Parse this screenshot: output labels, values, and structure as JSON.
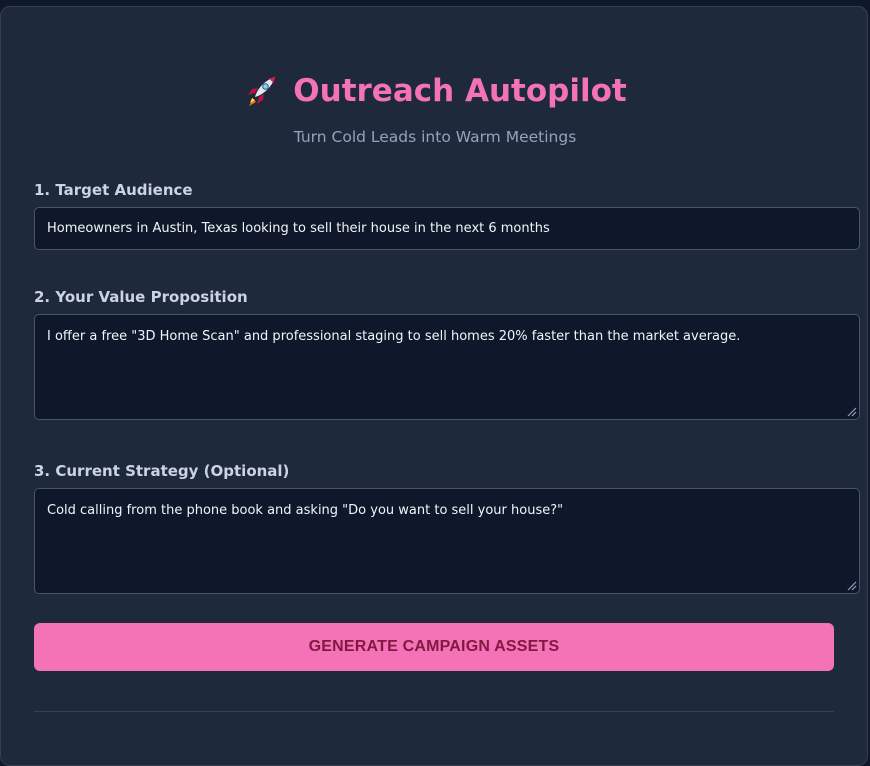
{
  "header": {
    "title": "Outreach Autopilot",
    "subtitle": "Turn Cold Leads into Warm Meetings",
    "icon": "rocket-icon"
  },
  "form": {
    "audience": {
      "label": "1. Target Audience",
      "value": "Homeowners in Austin, Texas looking to sell their house in the next 6 months"
    },
    "value_prop": {
      "label": "2. Your Value Proposition",
      "value": "I offer a free \"3D Home Scan\" and professional staging to sell homes 20% faster than the market average."
    },
    "strategy": {
      "label": "3. Current Strategy (Optional)",
      "value": "Cold calling from the phone book and asking \"Do you want to sell your house?\""
    },
    "submit_label": "GENERATE CAMPAIGN ASSETS"
  },
  "colors": {
    "accent": "#f472b6",
    "card_bg": "#1e293b",
    "field_bg": "#0f172a",
    "button_text": "#831843"
  }
}
